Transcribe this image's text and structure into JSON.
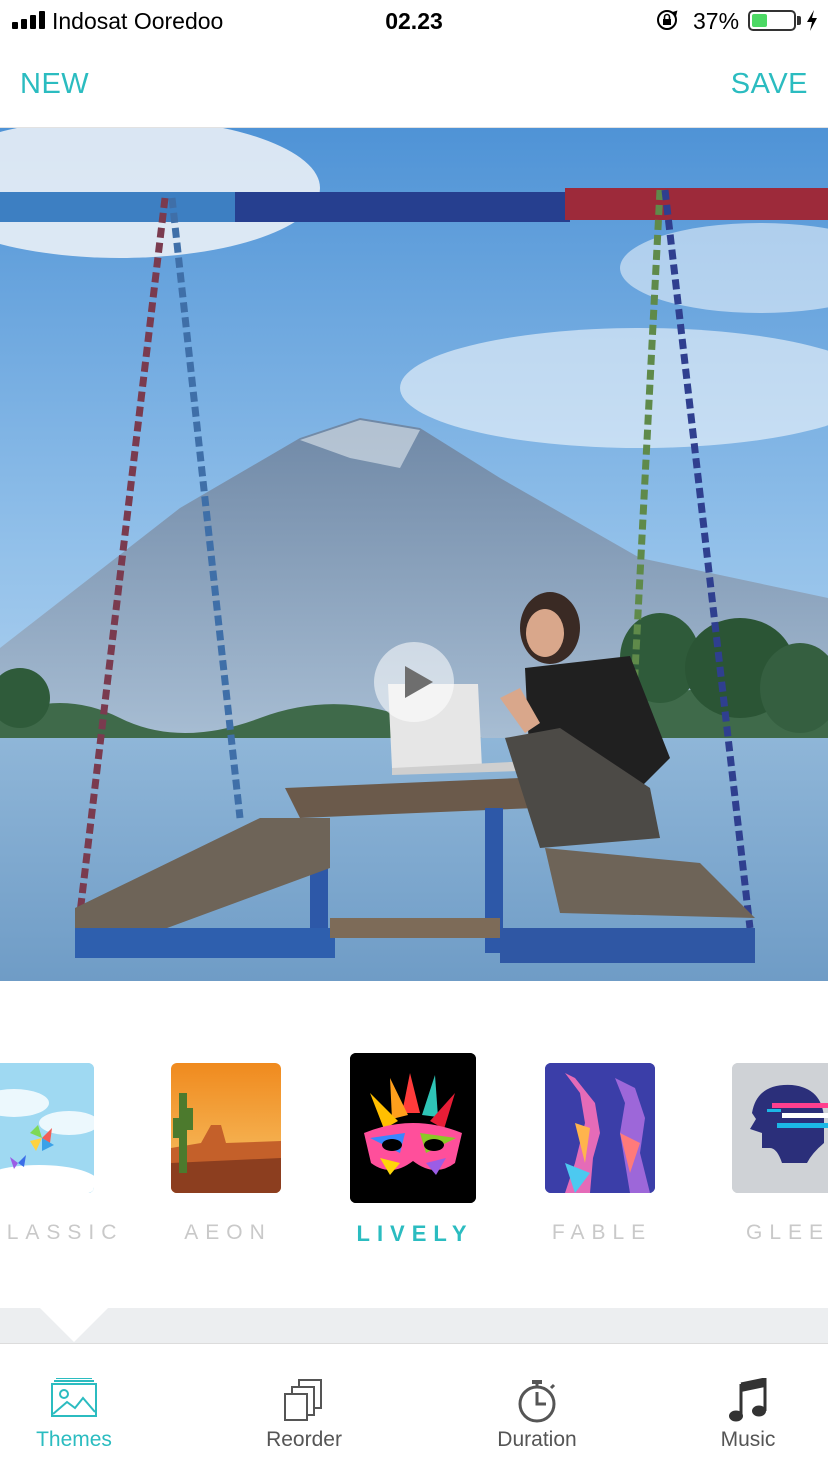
{
  "status_bar": {
    "carrier": "Indosat Ooredoo",
    "time": "02.23",
    "battery_percent": "37%",
    "battery_level": 0.37,
    "icons": [
      "signal-icon",
      "lock-rotation-icon",
      "battery-icon",
      "charging-bolt-icon"
    ]
  },
  "nav": {
    "new_label": "NEW",
    "save_label": "SAVE"
  },
  "preview": {
    "play_icon": "play-icon"
  },
  "themes": {
    "items": [
      {
        "label": "CLASSIC",
        "selected": false
      },
      {
        "label": "AEON",
        "selected": false
      },
      {
        "label": "LIVELY",
        "selected": true
      },
      {
        "label": "FABLE",
        "selected": false
      },
      {
        "label": "GLEE",
        "selected": false
      }
    ]
  },
  "tabs": [
    {
      "label": "Themes",
      "icon": "image-icon",
      "active": true
    },
    {
      "label": "Reorder",
      "icon": "copy-icon",
      "active": false
    },
    {
      "label": "Duration",
      "icon": "stopwatch-icon",
      "active": false
    },
    {
      "label": "Music",
      "icon": "music-note-icon",
      "active": false
    }
  ],
  "colors": {
    "accent": "#2bbcc0",
    "inactive_label": "#c9c9c9",
    "battery": "#4cd964"
  }
}
